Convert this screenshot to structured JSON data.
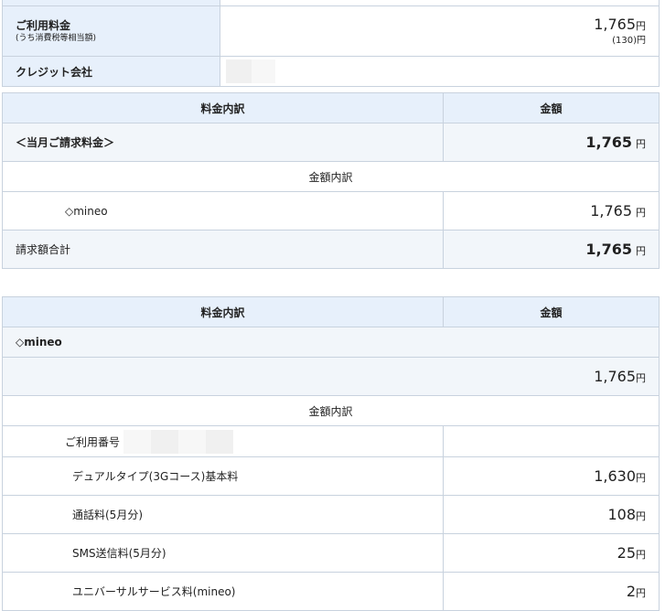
{
  "top_table": {
    "usage_fee_label": "ご利用料金",
    "usage_fee_sub": "(うち消費税等相当額)",
    "usage_fee_amount": "1,765",
    "usage_fee_tax": "(130)",
    "yen": "円",
    "credit_company_label": "クレジット会社"
  },
  "summary_table": {
    "header_item": "料金内訳",
    "header_amount": "金額",
    "monthly_label": "＜当月ご請求料金＞",
    "monthly_amount": "1,765",
    "breakdown_label": "金額内訳",
    "mineo_label": "◇mineo",
    "mineo_amount": "1,765",
    "total_label": "請求額合計",
    "total_amount": "1,765",
    "yen": "円"
  },
  "detail_table": {
    "header_item": "料金内訳",
    "header_amount": "金額",
    "section_label": "◇mineo",
    "section_amount": "1,765",
    "breakdown_label": "金額内訳",
    "usage_number_label": "ご利用番号",
    "yen": "円",
    "items": [
      {
        "label": "デュアルタイプ(3Gコース)基本料",
        "amount": "1,630"
      },
      {
        "label": "通話料(5月分)",
        "amount": "108"
      },
      {
        "label": "SMS送信料(5月分)",
        "amount": "25"
      },
      {
        "label": "ユニバーサルサービス料(mineo)",
        "amount": "2"
      }
    ]
  }
}
